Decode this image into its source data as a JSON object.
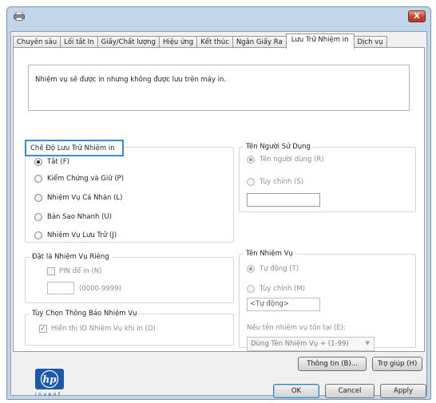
{
  "window": {
    "close_glyph": "X"
  },
  "tabs": [
    "Chuyên sâu",
    "Lối tắt In",
    "Giấy/Chất lượng",
    "Hiệu ứng",
    "Kết thúc",
    "Ngăn Giấy Ra",
    "Lưu Trữ Nhiệm in",
    "Dịch vụ"
  ],
  "active_tab": "Lưu Trữ Nhiệm in",
  "message": "Nhiệm vụ sẽ được in nhưng không được lưu trên máy in.",
  "job_mode": {
    "legend": "Chế Độ Lưu Trữ Nhiệm in",
    "options": [
      "Tắt (F)",
      "Kiểm Chứng và Giữ (P)",
      "Nhiệm Vụ Cá Nhân (L)",
      "Bản Sao Nhanh (U)",
      "Nhiệm Vụ Lưu Trữ (J)"
    ],
    "selected": "Tắt (F)"
  },
  "user_name": {
    "legend": "Tên Người Sử Dụng",
    "options": [
      "Tên người dùng (R)",
      "Tùy chỉnh (S)"
    ],
    "selected": "Tên người dùng (R)",
    "custom_value": ""
  },
  "private": {
    "legend": "Đặt là Nhiệm Vụ Riêng",
    "pin_label": "PIN để in (N)",
    "pin_value": "",
    "pin_hint": "(0000-9999)"
  },
  "notify": {
    "legend": "Tùy Chọn Thông Báo Nhiệm Vụ",
    "checkbox_label": "Hiển thị ID Nhiệm Vụ khi in (D)",
    "checked": true
  },
  "job_name": {
    "legend": "Tên Nhiệm Vụ",
    "options": [
      "Tự động (T)",
      "Tùy chỉnh (M)"
    ],
    "selected": "Tự động (T)",
    "custom_value": "<Tự động>",
    "exists_label": "Nếu tên nhiệm vụ tồn tại (E):",
    "exists_value": "Dùng Tên Nhiệm Vụ + (1-99)"
  },
  "logo": {
    "text": "hp",
    "tagline": "invent"
  },
  "buttons": {
    "info": "Thông tin (B)...",
    "help": "Trợ giúp (H)",
    "ok": "OK",
    "cancel": "Cancel",
    "apply": "Apply"
  },
  "colors": {
    "accent": "#3b8dd1",
    "hp_blue": "#1b5aa8",
    "frame": "#c2d6ea"
  }
}
